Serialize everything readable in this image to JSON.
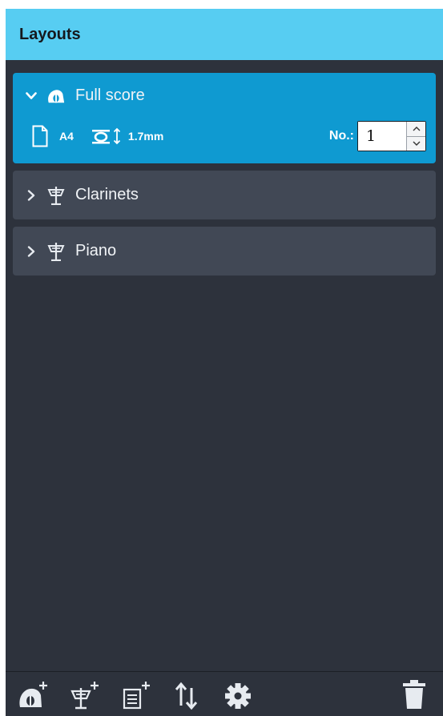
{
  "header": {
    "title": "Layouts"
  },
  "layouts": [
    {
      "label": "Full score",
      "icon": "full-score-icon",
      "expanded": true,
      "selected": true,
      "page_size": "A4",
      "staff_size": "1.7mm",
      "number_label": "No.:",
      "number_value": "1"
    },
    {
      "label": "Clarinets",
      "icon": "part-icon",
      "expanded": false,
      "selected": false
    },
    {
      "label": "Piano",
      "icon": "part-icon",
      "expanded": false,
      "selected": false
    }
  ],
  "toolbar": {
    "buttons": [
      {
        "icon": "add-full-score-icon"
      },
      {
        "icon": "add-part-icon"
      },
      {
        "icon": "add-custom-layout-icon"
      },
      {
        "icon": "sort-icon"
      },
      {
        "icon": "settings-gear-icon"
      },
      {
        "icon": "trash-icon"
      }
    ]
  },
  "colors": {
    "header_bg": "#57cdf2",
    "panel_bg": "#2d323c",
    "selected_item_bg": "#0f9ad1",
    "item_bg": "#414855"
  }
}
